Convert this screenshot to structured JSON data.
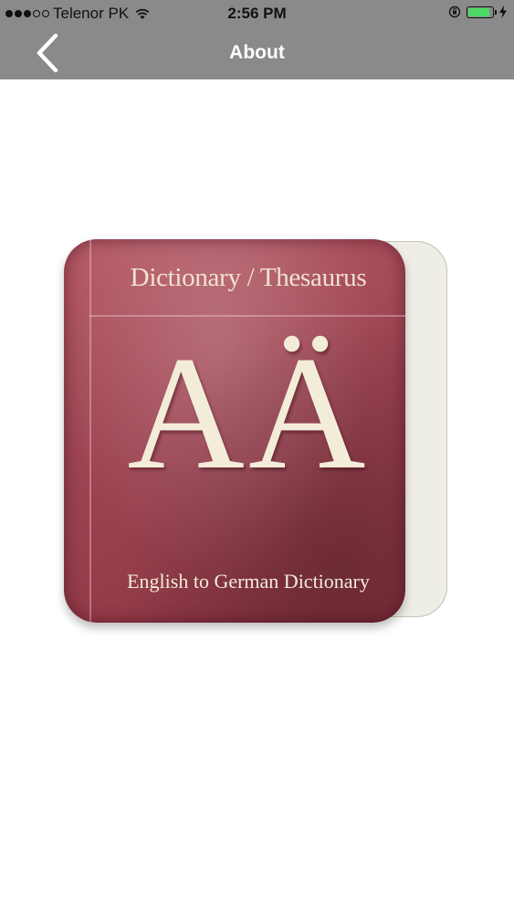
{
  "status_bar": {
    "carrier": "Telenor PK",
    "time": "2:56 PM",
    "battery_level": 0.9,
    "battery_color": "#4cd964",
    "signal_bars_filled": 3,
    "signal_bars_total": 5,
    "icons": [
      "wifi-icon",
      "orientation-lock-icon",
      "charging-bolt-icon"
    ]
  },
  "nav": {
    "title": "About",
    "back_icon": "chevron-left-icon",
    "background": "#8a8a8a"
  },
  "app_icon": {
    "header_text": "Dictionary / Thesaurus",
    "letters": "AÄ",
    "footer_text": "English to German Dictionary",
    "cover_color": "#9e4553"
  }
}
